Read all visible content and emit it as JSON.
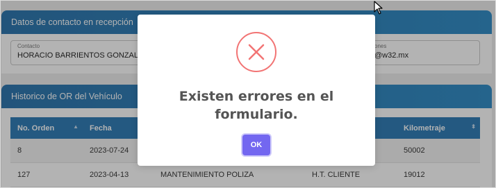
{
  "contact_section": {
    "title": "Datos de contacto en recepción",
    "contact_field": {
      "label": "Contacto",
      "value": "HORACIO BARRIENTOS GONZALEZ"
    },
    "observations_field": {
      "label": "ones",
      "value": "@w32.mx"
    }
  },
  "history_section": {
    "title": "Historico de OR del Vehículo",
    "columns": [
      {
        "label": "No. Orden",
        "sort": "▲"
      },
      {
        "label": "Fecha",
        "sort": ""
      },
      {
        "label": "",
        "sort": ""
      },
      {
        "label": "",
        "sort": ""
      },
      {
        "label": "Kilometraje",
        "sort": "⬍"
      }
    ],
    "rows": [
      {
        "order": "8",
        "date": "2023-07-24",
        "service": "",
        "client": "",
        "km": "50002"
      },
      {
        "order": "127",
        "date": "2023-04-13",
        "service": "MANTENIMIENTO POLIZA",
        "client": "H.T. CLIENTE",
        "km": "19012"
      }
    ]
  },
  "modal": {
    "icon": "error-x-icon",
    "title_line1": "Existen errores en el",
    "title_line2": "formulario.",
    "ok_label": "OK",
    "accent_color": "#7367f0",
    "error_color": "#f27474"
  }
}
